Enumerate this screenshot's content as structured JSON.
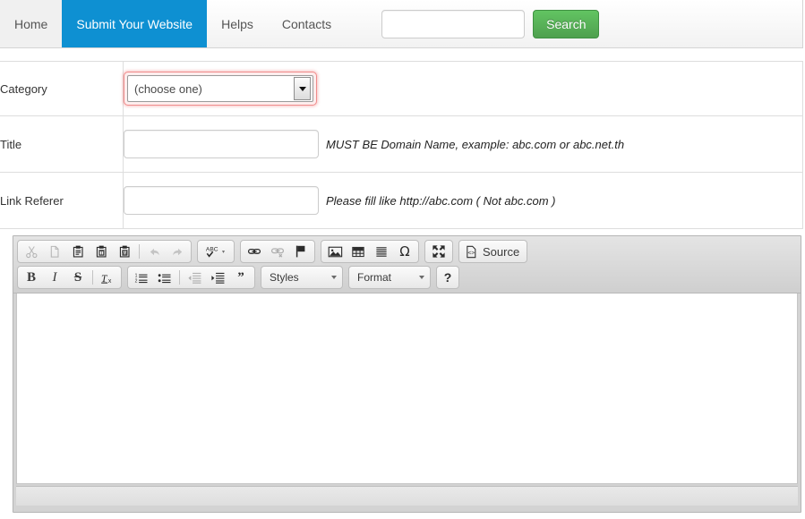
{
  "nav": {
    "items": [
      {
        "label": "Home",
        "active": false
      },
      {
        "label": "Submit Your Website",
        "active": true
      },
      {
        "label": "Helps",
        "active": false
      },
      {
        "label": "Contacts",
        "active": false
      }
    ],
    "search": {
      "value": "",
      "placeholder": "",
      "button_label": "Search"
    },
    "active_color": "#0e90d2",
    "search_button_color": "#4fa04f"
  },
  "form": {
    "rows": [
      {
        "label": "Category",
        "type": "select",
        "value": "(choose one)",
        "hint": "",
        "focus_ring_color": "#f08c8c"
      },
      {
        "label": "Title",
        "type": "text",
        "value": "",
        "placeholder": "",
        "hint": "MUST BE Domain Name, example: abc.com or abc.net.th"
      },
      {
        "label": "Link Referer",
        "type": "text",
        "value": "",
        "placeholder": "",
        "hint": "Please fill like http://abc.com ( Not abc.com )"
      }
    ]
  },
  "editor": {
    "content": "",
    "footer_text": "",
    "toolbar_row1": [
      {
        "name": "cut",
        "title": "Cut",
        "disabled": true
      },
      {
        "name": "copy",
        "title": "Copy",
        "disabled": true
      },
      {
        "name": "paste",
        "title": "Paste",
        "disabled": false
      },
      {
        "name": "paste-text",
        "title": "Paste as plain text",
        "disabled": false
      },
      {
        "name": "paste-word",
        "title": "Paste from Word",
        "disabled": false
      },
      {
        "name": "separator",
        "title": "",
        "disabled": false
      },
      {
        "name": "undo",
        "title": "Undo",
        "disabled": true
      },
      {
        "name": "redo",
        "title": "Redo",
        "disabled": true
      }
    ],
    "toolbar_row1_spell": [
      {
        "name": "spellcheck",
        "title": "Check Spelling",
        "disabled": false
      }
    ],
    "toolbar_row1_links": [
      {
        "name": "link",
        "title": "Link",
        "disabled": false
      },
      {
        "name": "unlink",
        "title": "Unlink",
        "disabled": true
      },
      {
        "name": "anchor",
        "title": "Anchor",
        "disabled": false
      }
    ],
    "toolbar_row1_insert": [
      {
        "name": "image",
        "title": "Image",
        "disabled": false
      },
      {
        "name": "table",
        "title": "Table",
        "disabled": false
      },
      {
        "name": "horizontal-rule",
        "title": "Horizontal Line",
        "disabled": false
      },
      {
        "name": "special-char",
        "title": "Insert Special Character",
        "disabled": false
      }
    ],
    "toolbar_row1_tools": [
      {
        "name": "maximize",
        "title": "Maximize",
        "disabled": false
      }
    ],
    "source_button_label": "Source",
    "toolbar_row2_basic": [
      {
        "name": "bold",
        "title": "Bold",
        "glyph": "B",
        "disabled": false
      },
      {
        "name": "italic",
        "title": "Italic",
        "glyph": "I",
        "disabled": false
      },
      {
        "name": "strike",
        "title": "Strikethrough",
        "glyph": "S",
        "disabled": false
      },
      {
        "name": "separator",
        "title": "",
        "glyph": "",
        "disabled": false
      },
      {
        "name": "remove-format",
        "title": "Remove Format",
        "glyph": "Tx",
        "disabled": false
      }
    ],
    "toolbar_row2_para": [
      {
        "name": "numbered-list",
        "title": "Insert/Remove Numbered List",
        "disabled": false
      },
      {
        "name": "bulleted-list",
        "title": "Insert/Remove Bulleted List",
        "disabled": false
      },
      {
        "name": "separator",
        "title": "",
        "disabled": false
      },
      {
        "name": "outdent",
        "title": "Decrease Indent",
        "disabled": true
      },
      {
        "name": "indent",
        "title": "Increase Indent",
        "disabled": false
      },
      {
        "name": "blockquote",
        "title": "Block Quote",
        "disabled": false
      }
    ],
    "styles_combo": "Styles",
    "format_combo": "Format",
    "help_label": "?"
  }
}
